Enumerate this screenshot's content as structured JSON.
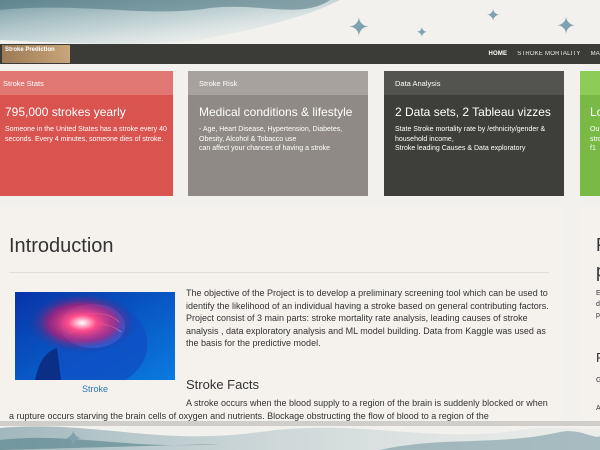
{
  "navbar": {
    "brand": "Stroke Prediction",
    "items": [
      {
        "label": "HOME",
        "active": true
      },
      {
        "label": "STROKE MORTALITY",
        "active": false
      },
      {
        "label": "MA",
        "active": false
      }
    ]
  },
  "cards": [
    {
      "header": "Stroke Stats",
      "title": "795,000 strokes yearly",
      "text": "Someone in the United States has a stroke every 40 seconds. Every 4 minutes, someone dies of stroke."
    },
    {
      "header": "Stroke Risk",
      "title": "Medical conditions & lifestyle",
      "text": "- Age, Heart Disease, Hypertension, Diabetes, Obesity, Alcohol & Tobacco use\ncan affect your chances of having a stroke"
    },
    {
      "header": "Data Analysis",
      "title": "2 Data sets, 2 Tableau vizzes",
      "text": "State Stroke mortality rate by /ethnicity/gender & household income,\nStroke leading Causes & Data exploratory"
    },
    {
      "header": "",
      "title": "Lo",
      "text": "Ou\nstro\nf1"
    }
  ],
  "intro": {
    "heading": "Introduction",
    "image_caption": "Stroke",
    "paragraph1": "The objective of the Project is to develop a preliminary screening tool which can be used to identify the likelihood of an individual having a stroke based on general contributing factors.",
    "paragraph2": "Project consist of 3 main parts: stroke mortality rate analysis, leading causes of stroke analysis , data exploratory analysis and ML model building. Data from Kaggle was used as the basis for the predictive model.",
    "facts_heading": "Stroke Facts",
    "facts_text": "A stroke occurs when the blood supply to a region of the brain is suddenly blocked or when a rupture occurs starving the brain cells of oxygen and nutrients. Blockage obstructing the flow of blood to a region of the"
  },
  "side_panel": {
    "line1": "F",
    "line2": "p",
    "line3": "E",
    "line4": "d",
    "line5": "p",
    "line6": "R",
    "line7": "G",
    "line8": "A"
  },
  "colors": {
    "navbar": "#3b3b38",
    "stats": "#d9534f",
    "risk": "#8f8a85",
    "analysis": "#3e3e3a",
    "link": "#2b78b8",
    "accent_green": "#79b945"
  }
}
